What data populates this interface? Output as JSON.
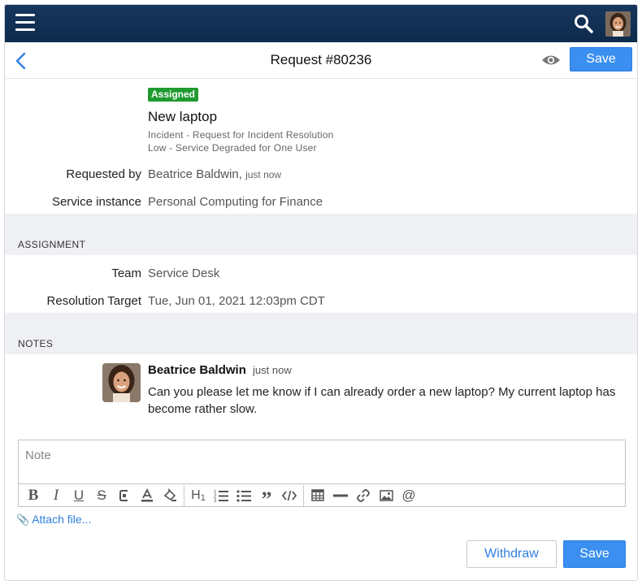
{
  "header": {
    "title": "Request #80236",
    "save_label": "Save"
  },
  "request": {
    "status_badge": "Assigned",
    "title": "New laptop",
    "category": "Incident - Request for Incident Resolution",
    "impact": "Low - Service Degraded for One User",
    "fields": [
      {
        "label": "Requested by",
        "value": "Beatrice Baldwin,",
        "extra": "just now"
      },
      {
        "label": "Service instance",
        "value": "Personal Computing for Finance"
      }
    ]
  },
  "assignment": {
    "section_label": "ASSIGNMENT",
    "fields": [
      {
        "label": "Team",
        "value": "Service Desk"
      },
      {
        "label": "Resolution Target",
        "value": "Tue, Jun 01, 2021 12:03pm CDT"
      }
    ]
  },
  "notes": {
    "section_label": "NOTES",
    "items": [
      {
        "author": "Beatrice Baldwin",
        "time": "just now",
        "text": "Can you please let me know if I can already order a new laptop? My current laptop has become rather slow."
      }
    ]
  },
  "editor": {
    "placeholder": "Note",
    "toolbar_icons": [
      "bold-icon",
      "italic-icon",
      "underline-icon",
      "strikethrough-icon",
      "clear-format-icon",
      "text-color-icon",
      "highlight-icon",
      "heading-icon",
      "numbered-list-icon",
      "bullet-list-icon",
      "quote-icon",
      "code-icon",
      "table-icon",
      "horizontal-rule-icon",
      "link-icon",
      "image-icon",
      "mention-icon"
    ]
  },
  "attach_label": "Attach file...",
  "actions": {
    "withdraw_label": "Withdraw",
    "save_label": "Save"
  },
  "colors": {
    "topbar": "#0e2b4d",
    "accent": "#3b8ff0",
    "badge_green": "#1f9a2f",
    "section_bg": "#eff0f3"
  }
}
